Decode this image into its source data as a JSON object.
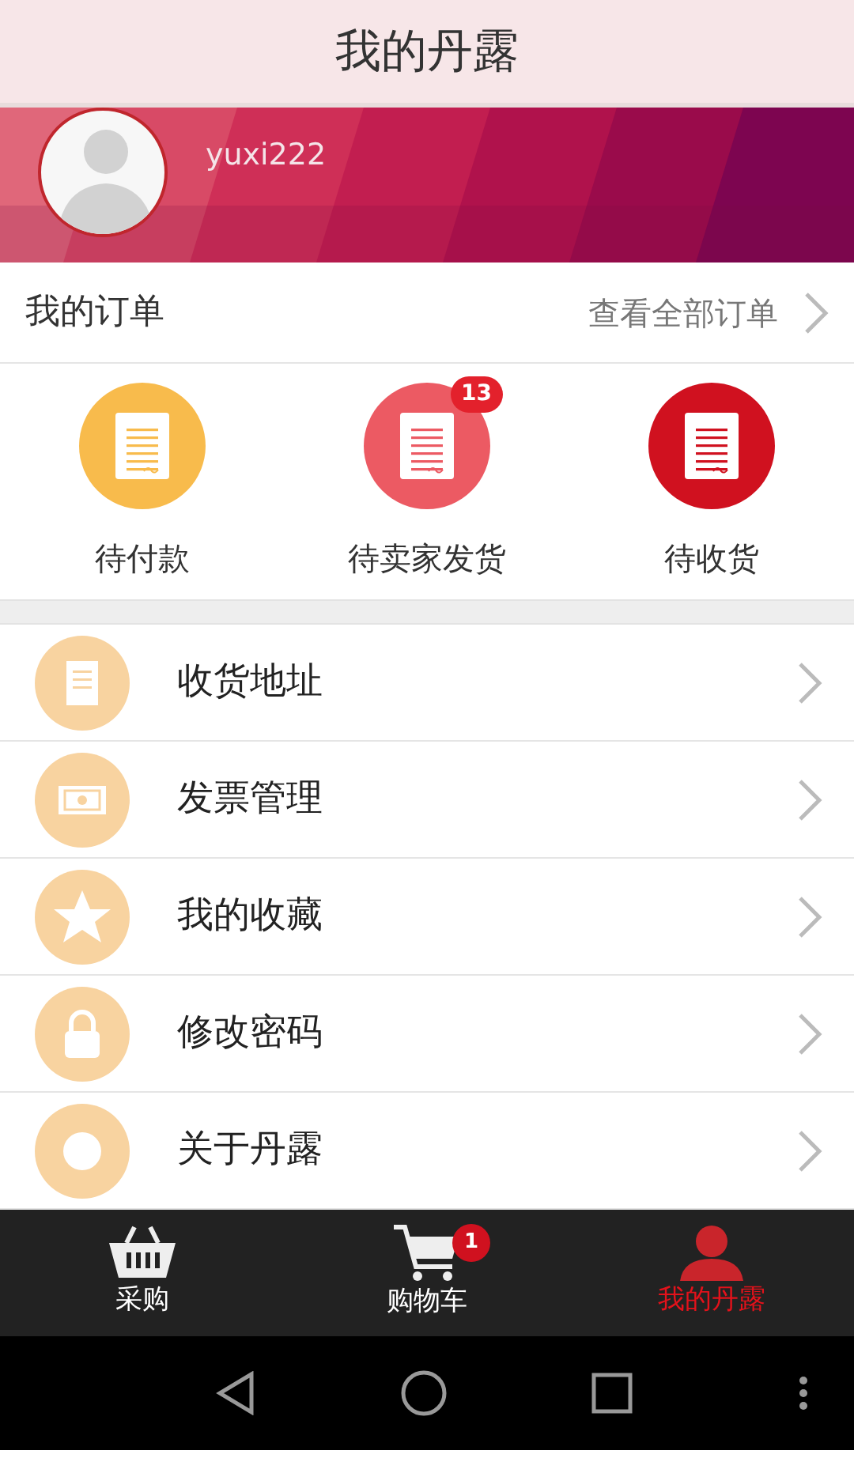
{
  "header": {
    "title": "我的丹露"
  },
  "profile": {
    "username": "yuxi222"
  },
  "orders": {
    "title": "我的订单",
    "view_all": "查看全部订单",
    "statuses": [
      {
        "label": "待付款",
        "color": "#f8bb4c"
      },
      {
        "label": "待卖家发货",
        "color": "#ec5a63",
        "badge": "13"
      },
      {
        "label": "待收货",
        "color": "#d0111f"
      }
    ]
  },
  "menu": [
    {
      "kind": "address",
      "label": "收货地址"
    },
    {
      "kind": "invoice",
      "label": "发票管理"
    },
    {
      "kind": "favorites",
      "label": "我的收藏"
    },
    {
      "kind": "password",
      "label": "修改密码"
    },
    {
      "kind": "about",
      "label": "关于丹露"
    }
  ],
  "tabs": [
    {
      "kind": "basket",
      "label": "采购",
      "selected": false
    },
    {
      "kind": "cart",
      "label": "购物车",
      "selected": false,
      "badge": "1"
    },
    {
      "kind": "person",
      "label": "我的丹露",
      "selected": true
    }
  ]
}
